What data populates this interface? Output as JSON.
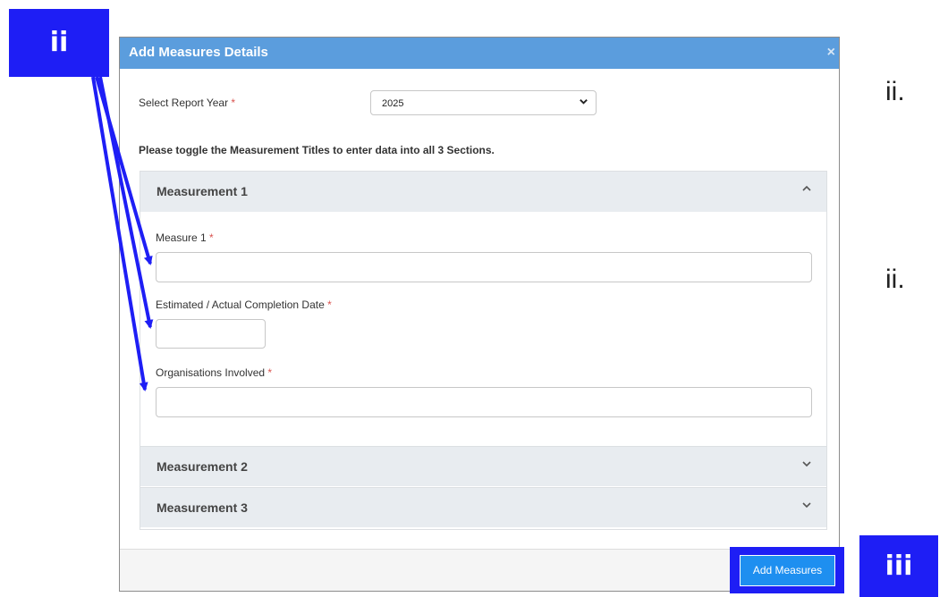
{
  "modal": {
    "title": "Add Measures Details",
    "close_glyph": "×",
    "report_year_label": "Select Report Year",
    "required_mark": "*",
    "report_year_value": "2025",
    "instructions": "Please toggle the Measurement Titles to enter data into all 3 Sections.",
    "sections": [
      {
        "title": "Measurement 1",
        "expanded": true
      },
      {
        "title": "Measurement 2",
        "expanded": false
      },
      {
        "title": "Measurement 3",
        "expanded": false
      }
    ],
    "fields": {
      "measure_label": "Measure 1",
      "date_label": "Estimated / Actual Completion Date",
      "orgs_label": "Organisations Involved"
    },
    "add_button": "Add Measures"
  },
  "annotations": {
    "badge_ii": "ii",
    "badge_iii": "iii",
    "note_1": "ii.",
    "note_2": "ii."
  },
  "icons": {
    "select_chevron": "chevron-down-icon",
    "expanded": "chevron-up-icon",
    "collapsed": "chevron-down-icon",
    "close": "close-icon"
  },
  "colors": {
    "header": "#5b9ddd",
    "annotation_blue": "#1e1ef5",
    "button": "#1e8ff0",
    "required": "#d9534f"
  }
}
